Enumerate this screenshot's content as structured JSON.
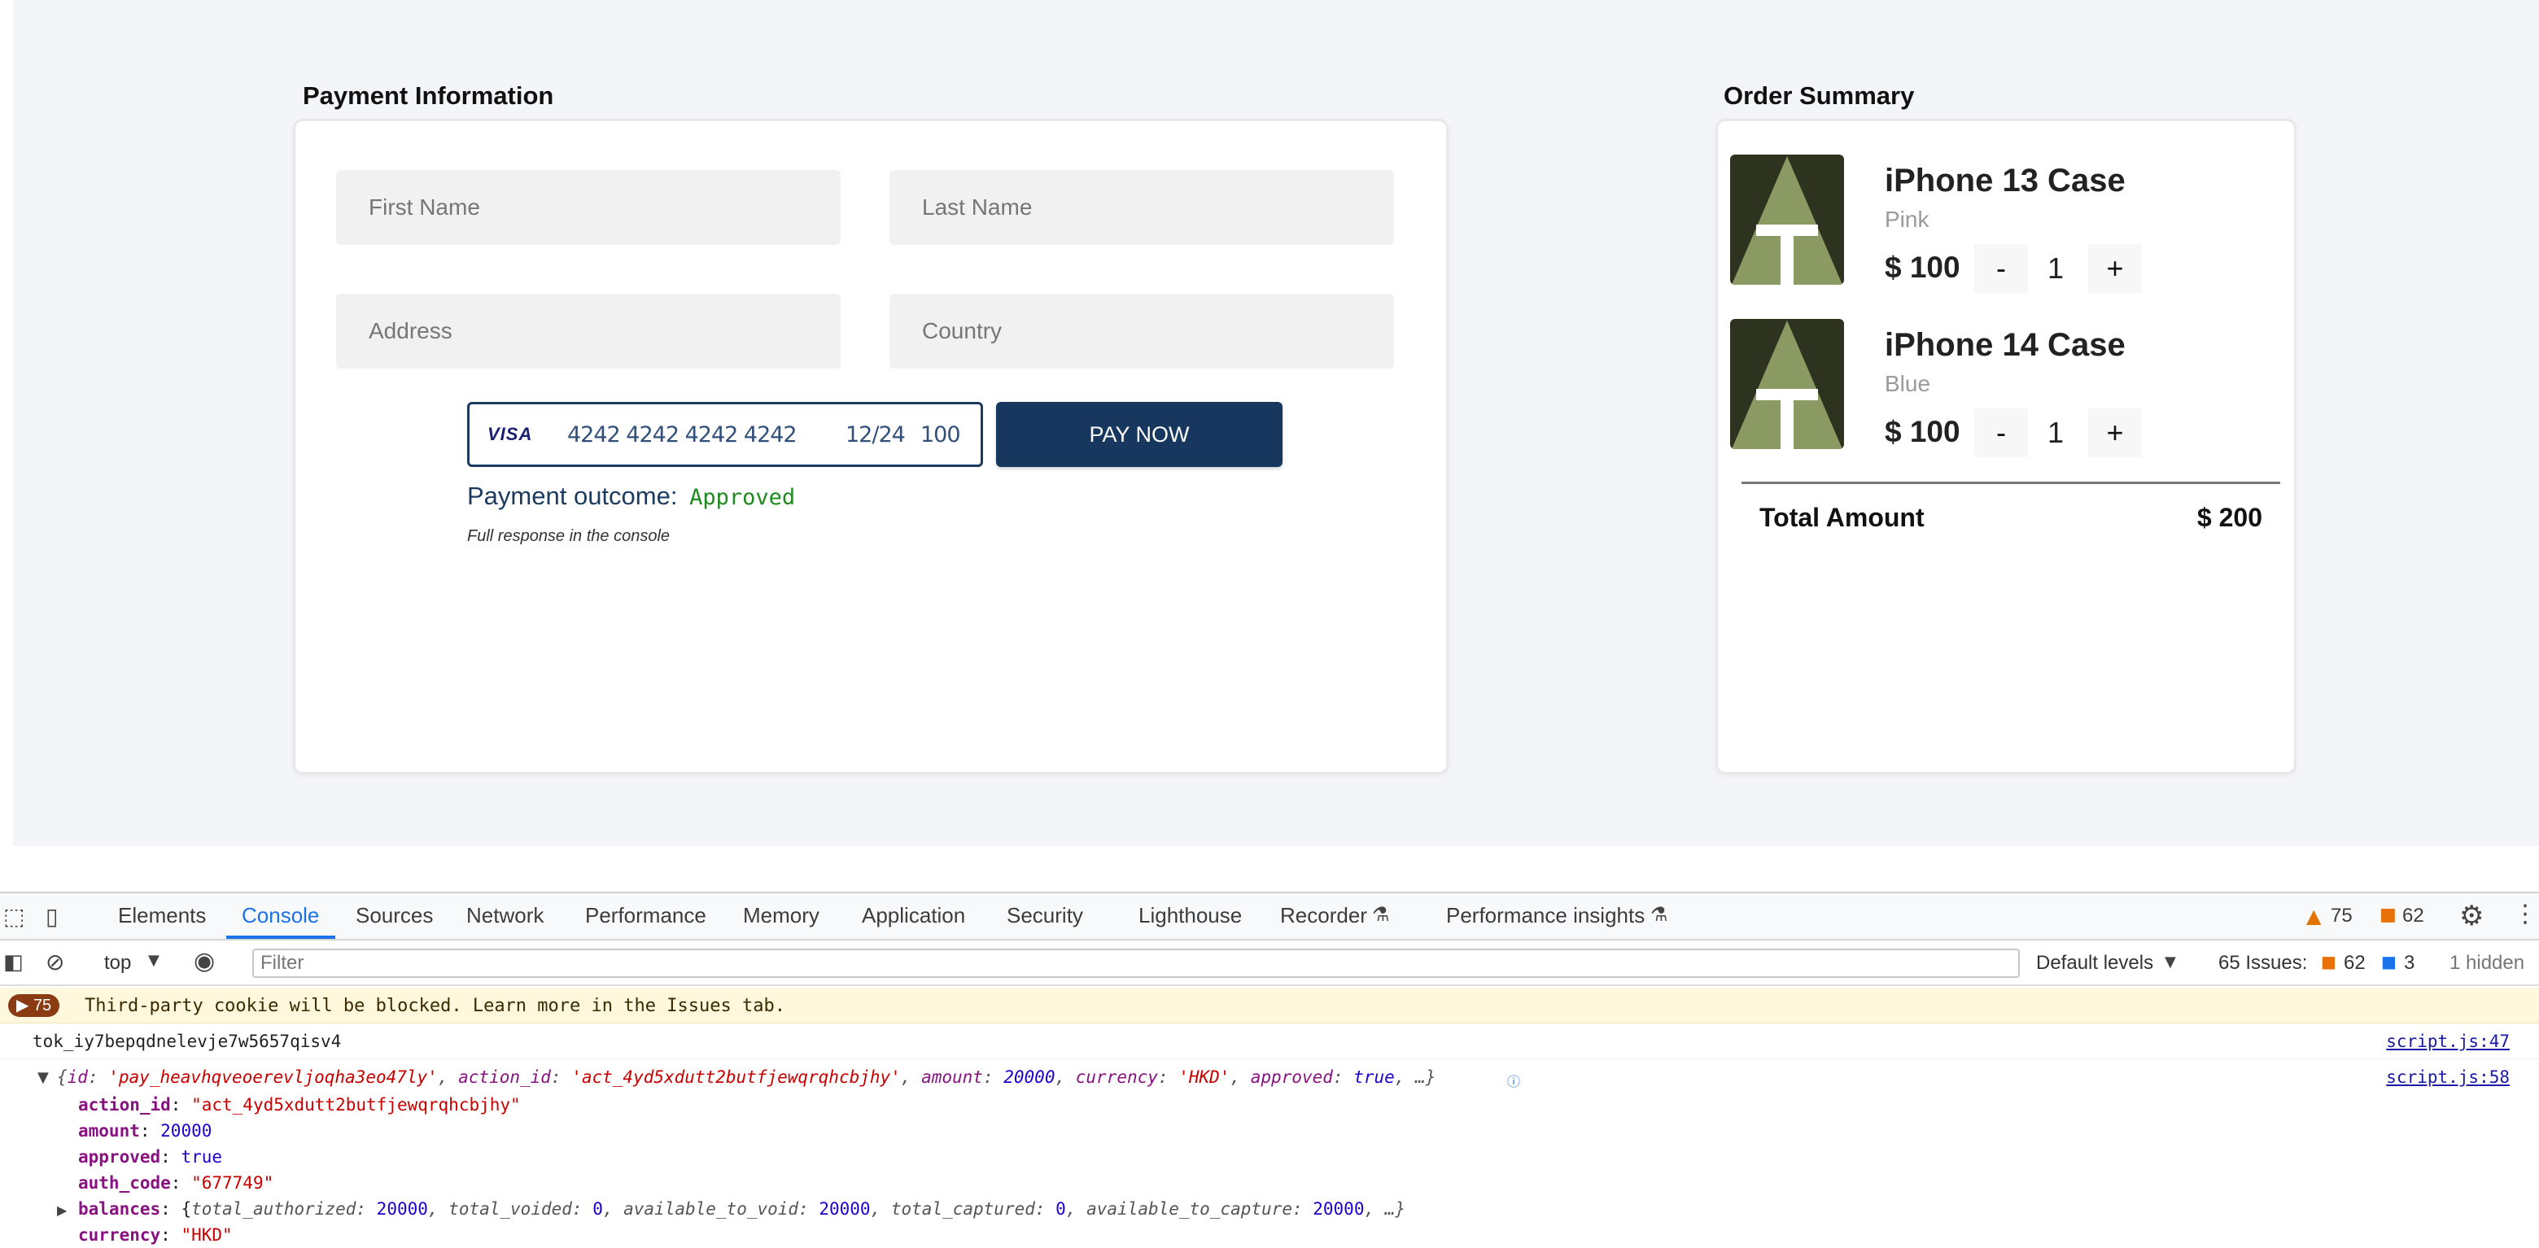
{
  "payment": {
    "title": "Payment Information",
    "first_name_placeholder": "First Name",
    "last_name_placeholder": "Last Name",
    "address_placeholder": "Address",
    "country_placeholder": "Country",
    "card_brand": "VISA",
    "card_number": "4242 4242 4242 4242",
    "card_expiry": "12/24",
    "card_cvc": "100",
    "pay_button": "PAY NOW",
    "outcome_label": "Payment outcome:",
    "outcome_value": "Approved",
    "full_response_note": "Full response in the console"
  },
  "order": {
    "title": "Order Summary",
    "items": [
      {
        "name": "iPhone 13 Case",
        "color": "Pink",
        "price": "$ 100",
        "qty": "1",
        "minus": "-",
        "plus": "+"
      },
      {
        "name": "iPhone 14 Case",
        "color": "Blue",
        "price": "$ 100",
        "qty": "1",
        "minus": "-",
        "plus": "+"
      }
    ],
    "total_label": "Total Amount",
    "total_value": "$ 200"
  },
  "devtools": {
    "tabs": [
      "Elements",
      "Console",
      "Sources",
      "Network",
      "Performance",
      "Memory",
      "Application",
      "Security",
      "Lighthouse",
      "Recorder",
      "Performance insights"
    ],
    "active_tab": "Console",
    "warning_count": "75",
    "error_count": "62",
    "context": "top",
    "filter_placeholder": "Filter",
    "levels": "Default levels",
    "issues_label": "65 Issues:",
    "issues_errors": "62",
    "issues_info": "3",
    "hidden": "1 hidden",
    "cookie_badge": "75",
    "cookie_warning": "Third-party cookie will be blocked. Learn more in the Issues tab.",
    "token_line": "tok_iy7bepqdnelevje7w5657qisv4",
    "token_source": "script.js:47",
    "object_source": "script.js:58",
    "object_summary": {
      "id": "'pay_heavhqveoerevljoqha3eo47ly'",
      "action_id": "'act_4yd5xdutt2butfjewqrqhcbjhy'",
      "amount": "20000",
      "currency": "'HKD'",
      "approved": "true"
    },
    "props": {
      "action_id": "\"act_4yd5xdutt2butfjewqrqhcbjhy\"",
      "amount": "20000",
      "approved": "true",
      "auth_code": "\"677749\"",
      "currency": "\"HKD\""
    },
    "balances": {
      "total_authorized": "20000",
      "total_voided": "0",
      "available_to_void": "20000",
      "total_captured": "0",
      "available_to_capture": "20000"
    }
  },
  "colors": {
    "primary": "#17375e",
    "approved": "#1f8a1f",
    "devtools_accent": "#1a73e8",
    "thumb_bg": "#2e3320",
    "thumb_shape": "#8b9a63"
  }
}
